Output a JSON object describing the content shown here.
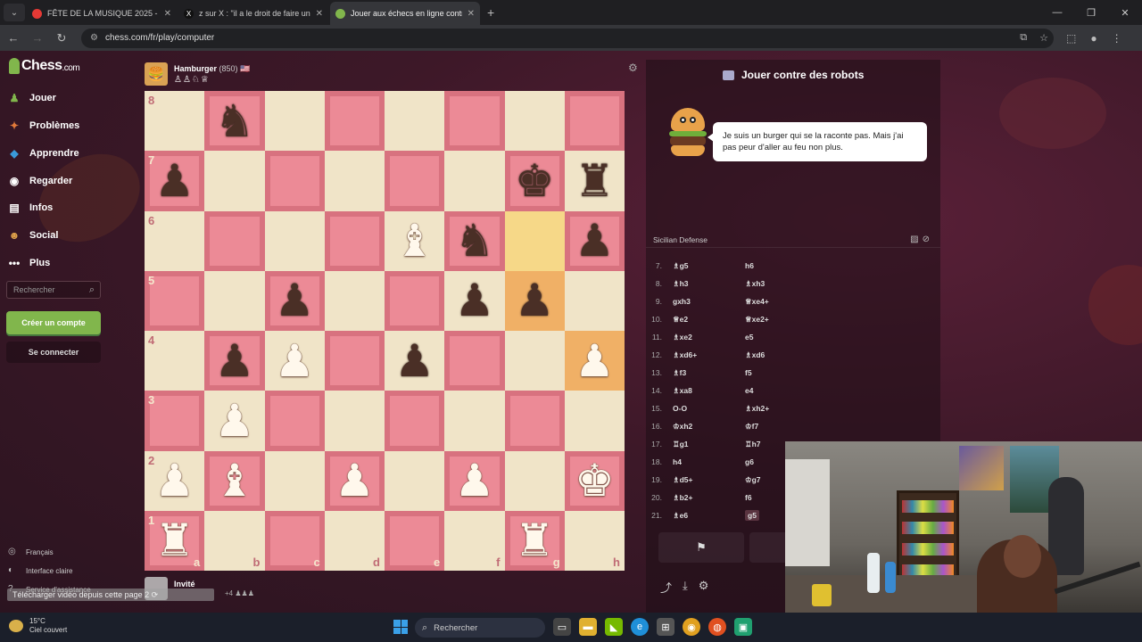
{
  "browser": {
    "tabs": [
      {
        "title": "FÊTE DE LA MUSIQUE 2025 - Yo",
        "color": "#e53935"
      },
      {
        "title": "z sur X : \"il a le droit de faire un",
        "color": "#111111"
      },
      {
        "title": "Jouer aux échecs en ligne contr",
        "color": "#81b64c"
      }
    ],
    "url": "chess.com/fr/play/computer"
  },
  "sidebar": {
    "logo": "Chess",
    "logo_suffix": ".com",
    "items": [
      {
        "label": "Jouer",
        "icon": "♟",
        "color": "#81b64c"
      },
      {
        "label": "Problèmes",
        "icon": "✦",
        "color": "#e27a3a"
      },
      {
        "label": "Apprendre",
        "icon": "◆",
        "color": "#3a9ad9"
      },
      {
        "label": "Regarder",
        "icon": "◉",
        "color": "#ddd"
      },
      {
        "label": "Infos",
        "icon": "▤",
        "color": "#ddd"
      },
      {
        "label": "Social",
        "icon": "☻",
        "color": "#e0a24a"
      },
      {
        "label": "Plus",
        "icon": "•••",
        "color": "#ddd"
      }
    ],
    "search_placeholder": "Rechercher",
    "create_account": "Créer un compte",
    "login": "Se connecter",
    "footer": [
      {
        "label": "Français",
        "icon": "🌐"
      },
      {
        "label": "Interface claire",
        "icon": "◐"
      },
      {
        "label": "Service d'assistance",
        "icon": "?"
      }
    ]
  },
  "game": {
    "top_player": {
      "name": "Hamburger",
      "rating": "(850)",
      "flag": "🇺🇸",
      "captured": "♙♙♘♕"
    },
    "bottom_player": {
      "name": "Invité",
      "advantage": "+4"
    },
    "board": [
      [
        "",
        "bn",
        "",
        "",
        "",
        "",
        "",
        ""
      ],
      [
        "bp",
        "",
        "",
        "",
        "",
        "",
        "bk",
        "br"
      ],
      [
        "",
        "",
        "",
        "",
        "wb",
        "bn",
        "",
        "bp"
      ],
      [
        "",
        "",
        "bp",
        "",
        "",
        "bp",
        "bp",
        ""
      ],
      [
        "",
        "bp",
        "wp",
        "",
        "bp",
        "",
        "",
        "wp"
      ],
      [
        "",
        "wp",
        "",
        "",
        "",
        "",
        "",
        ""
      ],
      [
        "wp",
        "wb",
        "",
        "wp",
        "",
        "wp",
        "",
        "wk"
      ],
      [
        "wr",
        "",
        "",
        "",
        "",
        "",
        "wr",
        ""
      ]
    ],
    "highlights": [
      "g6",
      "g5",
      "h4"
    ],
    "ranks": [
      "8",
      "7",
      "6",
      "5",
      "4",
      "3",
      "2",
      "1"
    ],
    "files": [
      "a",
      "b",
      "c",
      "d",
      "e",
      "f",
      "g",
      "h"
    ]
  },
  "panel": {
    "title": "Jouer contre des robots",
    "bot_message": "Je suis un burger qui se la raconte pas. Mais j'ai pas peur d'aller au feu non plus.",
    "opening": "Sicilian Defense",
    "moves": [
      {
        "n": "7.",
        "w": "♗g5",
        "b": "h6"
      },
      {
        "n": "8.",
        "w": "♗h3",
        "b": "♗xh3"
      },
      {
        "n": "9.",
        "w": "gxh3",
        "b": "♕xe4+"
      },
      {
        "n": "10.",
        "w": "♕e2",
        "b": "♕xe2+"
      },
      {
        "n": "11.",
        "w": "♗xe2",
        "b": "e5"
      },
      {
        "n": "12.",
        "w": "♗xd6+",
        "b": "♗xd6"
      },
      {
        "n": "13.",
        "w": "♗f3",
        "b": "f5"
      },
      {
        "n": "14.",
        "w": "♗xa8",
        "b": "e4"
      },
      {
        "n": "15.",
        "w": "O-O",
        "b": "♗xh2+"
      },
      {
        "n": "16.",
        "w": "♔xh2",
        "b": "♔f7"
      },
      {
        "n": "17.",
        "w": "♖g1",
        "b": "♖h7"
      },
      {
        "n": "18.",
        "w": "h4",
        "b": "g6"
      },
      {
        "n": "19.",
        "w": "♗d5+",
        "b": "♔g7"
      },
      {
        "n": "20.",
        "w": "♗b2+",
        "b": "f6"
      },
      {
        "n": "21.",
        "w": "♗e6",
        "b": "g5"
      }
    ]
  },
  "overlay": {
    "download": "Télécharger vidéo depuis cette page  2 ⟳"
  },
  "taskbar": {
    "temp": "15°C",
    "weather": "Ciel couvert",
    "search": "Rechercher"
  }
}
